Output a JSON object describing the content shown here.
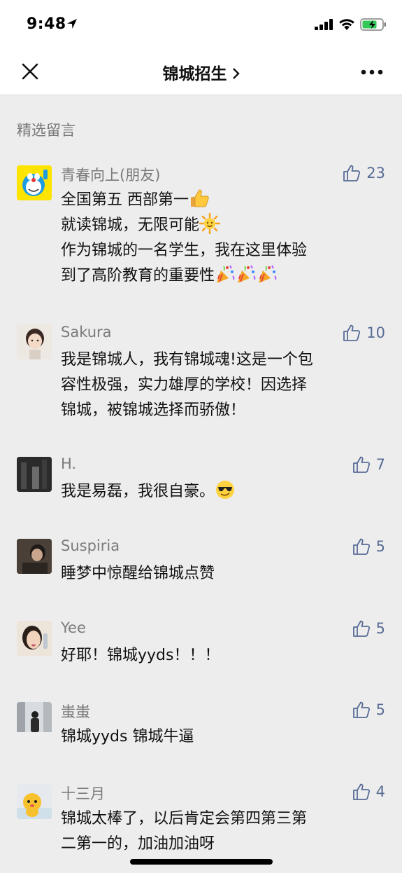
{
  "status_bar": {
    "time": "9:48"
  },
  "nav": {
    "title": "锦城招生"
  },
  "section_title": "精选留言",
  "comments": [
    {
      "name": "青春向上(朋友)",
      "likes": "23",
      "lines": [
        "全国第五 西部第一",
        "就读锦城，无限可能",
        "作为锦城的一名学生，我在这里体验",
        "到了高阶教育的重要性"
      ]
    },
    {
      "name": "Sakura",
      "likes": "10",
      "lines": [
        "我是锦城人，我有锦城魂!这是一个包",
        "容性极强，实力雄厚的学校！因选择",
        "锦城，被锦城选择而骄傲！"
      ]
    },
    {
      "name": "H.",
      "likes": "7",
      "lines": [
        "我是易磊，我很自豪。"
      ]
    },
    {
      "name": "Suspiria",
      "likes": "5",
      "lines": [
        "睡梦中惊醒给锦城点赞"
      ]
    },
    {
      "name": "Yee",
      "likes": "5",
      "lines": [
        "好耶！锦城yyds！！！"
      ]
    },
    {
      "name": "蚩蚩",
      "likes": "5",
      "lines": [
        "锦城yyds 锦城牛逼"
      ]
    },
    {
      "name": "十三月",
      "likes": "4",
      "lines": [
        "锦城太棒了，以后肯定会第四第三第",
        "二第一的，加油加油呀"
      ]
    }
  ],
  "colors": {
    "like_blue": "#576B95",
    "name_gray": "#7B7B7B",
    "background": "#EDEDED"
  },
  "icons": [
    "location-arrow-icon",
    "signal-icon",
    "wifi-icon",
    "battery-charging-icon",
    "close-icon",
    "chevron-right-icon",
    "more-icon",
    "thumbs-up-icon",
    "thumbs-up-emoji",
    "sun-emoji",
    "party-popper-emoji",
    "cool-sunglasses-emoji"
  ]
}
